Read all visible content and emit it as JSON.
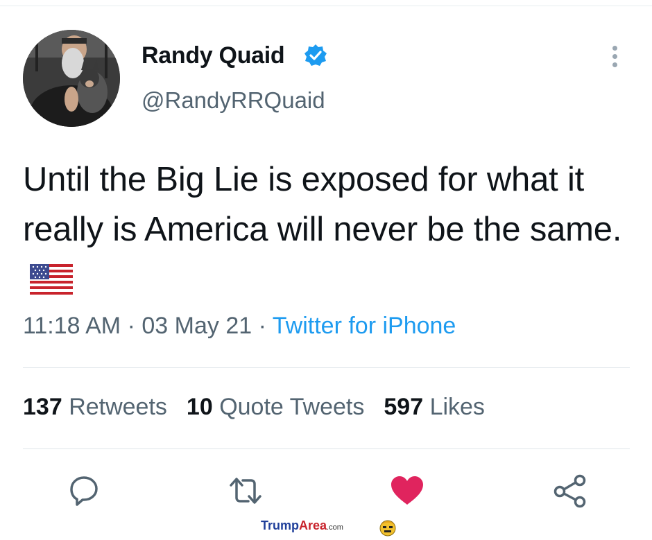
{
  "tweet": {
    "author_name": "Randy Quaid",
    "handle": "@RandyRRQuaid",
    "text": "Until the Big Lie is exposed for what it really is America will never be the same.",
    "emoji": "us-flag-emoji",
    "time": "11:18 AM",
    "separator": "·",
    "date": "03 May 21",
    "source": "Twitter for iPhone"
  },
  "stats": {
    "retweets_count": "137",
    "retweets_label": "Retweets",
    "quotes_count": "10",
    "quotes_label": "Quote Tweets",
    "likes_count": "597",
    "likes_label": "Likes"
  },
  "actions": [
    "reply-icon",
    "retweet-icon",
    "like-icon",
    "share-icon"
  ],
  "colors": {
    "verified": "#1d9bf0",
    "link": "#1d9bf0",
    "like": "#e0245e",
    "secondary_text": "#536471",
    "icon_gray": "#536471"
  },
  "watermark": {
    "part1": "Trump",
    "part2": "Area",
    "part3": ".com"
  }
}
